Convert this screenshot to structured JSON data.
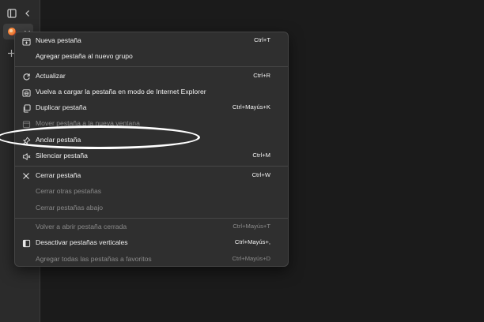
{
  "sidebar": {
    "icons": [
      "panel-icon",
      "chevron-left-icon",
      "chevron-down-icon",
      "plus-icon"
    ]
  },
  "menu": {
    "items": [
      {
        "label": "Nueva pestaña",
        "shortcut": "Ctrl+T",
        "icon": "new-tab-icon",
        "enabled": true
      },
      {
        "label": "Agregar pestaña al nuevo grupo",
        "shortcut": "",
        "icon": "",
        "enabled": true
      },
      {
        "label": "Actualizar",
        "shortcut": "Ctrl+R",
        "icon": "refresh-icon",
        "enabled": true
      },
      {
        "label": "Vuelva a cargar la pestaña en modo de Internet Explorer",
        "shortcut": "",
        "icon": "ie-mode-icon",
        "enabled": true
      },
      {
        "label": "Duplicar pestaña",
        "shortcut": "Ctrl+Mayús+K",
        "icon": "duplicate-icon",
        "enabled": true
      },
      {
        "label": "Mover pestaña a la nueva ventana",
        "shortcut": "",
        "icon": "window-icon",
        "enabled": false
      },
      {
        "label": "Anclar pestaña",
        "shortcut": "",
        "icon": "pin-icon",
        "enabled": true
      },
      {
        "label": "Silenciar pestaña",
        "shortcut": "Ctrl+M",
        "icon": "mute-icon",
        "enabled": true
      },
      {
        "label": "Cerrar pestaña",
        "shortcut": "Ctrl+W",
        "icon": "close-icon",
        "enabled": true
      },
      {
        "label": "Cerrar otras pestañas",
        "shortcut": "",
        "icon": "",
        "enabled": false
      },
      {
        "label": "Cerrar pestañas abajo",
        "shortcut": "",
        "icon": "",
        "enabled": false
      },
      {
        "label": "Volver a abrir pestaña cerrada",
        "shortcut": "Ctrl+Mayús+T",
        "icon": "",
        "enabled": false
      },
      {
        "label": "Desactivar pestañas verticales",
        "shortcut": "Ctrl+Mayús+,",
        "icon": "vertical-tabs-icon",
        "enabled": true
      },
      {
        "label": "Agregar todas las pestañas a favoritos",
        "shortcut": "Ctrl+Mayús+D",
        "icon": "",
        "enabled": false
      }
    ]
  },
  "colors": {
    "menu_bg": "#2f2f2f",
    "text": "#f2f2f2",
    "disabled_text": "#8a8a8a",
    "highlight": "#ffffff"
  }
}
